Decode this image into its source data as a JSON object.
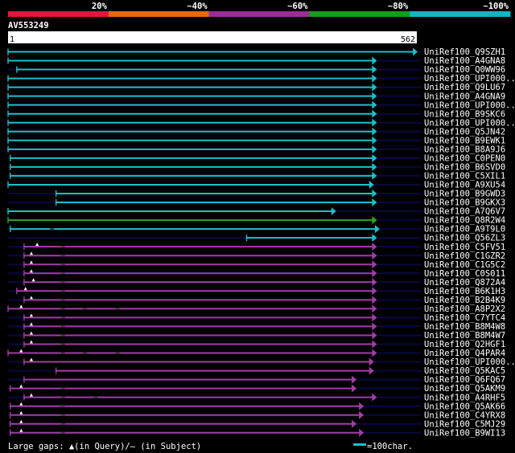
{
  "legend_scale": {
    "labels": [
      "20%",
      "~40%",
      "~60%",
      "~80%",
      "~100%"
    ],
    "colors": [
      "#e5143b",
      "#e06a17",
      "#9a2d98",
      "#1a9b1a",
      "#17b4bf"
    ]
  },
  "query": {
    "name": "AV553249",
    "start": "1",
    "end": "562",
    "length": 562
  },
  "colors": {
    "cyan": "#19c1c9",
    "purple": "#a23da5",
    "green": "#2aa81f",
    "nav": "#080840",
    "gap_mark": "#ffffff"
  },
  "hits": [
    {
      "name": "UniRef100_Q9SZH1",
      "color": "cyan",
      "start": 0,
      "end": 562,
      "gaps": []
    },
    {
      "name": "UniRef100_A4GNA8",
      "color": "cyan",
      "start": 0,
      "end": 506,
      "gaps": []
    },
    {
      "name": "UniRef100_Q0WW96",
      "color": "cyan",
      "start": 12,
      "end": 506,
      "gaps": []
    },
    {
      "name": "UniRef100_UPI000..",
      "color": "cyan",
      "start": 0,
      "end": 506,
      "gaps": []
    },
    {
      "name": "UniRef100_Q9LU67",
      "color": "cyan",
      "start": 0,
      "end": 506,
      "gaps": []
    },
    {
      "name": "UniRef100_A4GNA9",
      "color": "cyan",
      "start": 0,
      "end": 506,
      "gaps": []
    },
    {
      "name": "UniRef100_UPI000..",
      "color": "cyan",
      "start": 0,
      "end": 506,
      "gaps": []
    },
    {
      "name": "UniRef100_B9SKC6",
      "color": "cyan",
      "start": 0,
      "end": 506,
      "gaps": []
    },
    {
      "name": "UniRef100_UPI000..",
      "color": "cyan",
      "start": 0,
      "end": 506,
      "gaps": []
    },
    {
      "name": "UniRef100_Q5JN42",
      "color": "cyan",
      "start": 0,
      "end": 506,
      "gaps": []
    },
    {
      "name": "UniRef100_B9EWK1",
      "color": "cyan",
      "start": 0,
      "end": 506,
      "gaps": []
    },
    {
      "name": "UniRef100_B8A9J6",
      "color": "cyan",
      "start": 0,
      "end": 506,
      "gaps": []
    },
    {
      "name": "UniRef100_C0PEN0",
      "color": "cyan",
      "start": 3,
      "end": 506,
      "gaps": []
    },
    {
      "name": "UniRef100_B6SVD0",
      "color": "cyan",
      "start": 3,
      "end": 506,
      "gaps": []
    },
    {
      "name": "UniRef100_C5XIL1",
      "color": "cyan",
      "start": 3,
      "end": 506,
      "gaps": []
    },
    {
      "name": "UniRef100_A9XU54",
      "color": "cyan",
      "start": 0,
      "end": 502,
      "gaps": []
    },
    {
      "name": "UniRef100_B9GWD3",
      "color": "cyan",
      "start": 66,
      "end": 506,
      "gaps": []
    },
    {
      "name": "UniRef100_B9GKX3",
      "color": "cyan",
      "start": 66,
      "end": 506,
      "gaps": []
    },
    {
      "name": "UniRef100_A7Q6V7",
      "color": "cyan",
      "start": 0,
      "end": 450,
      "gaps": []
    },
    {
      "name": "UniRef100_Q8R2W4",
      "color": "green",
      "start": 0,
      "end": 506,
      "gaps": []
    },
    {
      "name": "UniRef100_A9T9L0",
      "color": "cyan",
      "start": 3,
      "end": 510,
      "gaps": [
        60
      ]
    },
    {
      "name": "UniRef100_Q56ZL3",
      "color": "cyan",
      "start": 328,
      "end": 506,
      "gaps": []
    },
    {
      "name": "UniRef100_C5FV51",
      "color": "purple",
      "start": 22,
      "end": 506,
      "gaps": [
        40,
        75
      ]
    },
    {
      "name": "UniRef100_C1GZR2",
      "color": "purple",
      "start": 22,
      "end": 506,
      "gaps": [
        32,
        75
      ]
    },
    {
      "name": "UniRef100_C1G5C2",
      "color": "purple",
      "start": 22,
      "end": 506,
      "gaps": [
        32,
        75
      ]
    },
    {
      "name": "UniRef100_C0S011",
      "color": "purple",
      "start": 22,
      "end": 506,
      "gaps": [
        32,
        75
      ]
    },
    {
      "name": "UniRef100_Q872A4",
      "color": "purple",
      "start": 22,
      "end": 506,
      "gaps": [
        35,
        75
      ]
    },
    {
      "name": "UniRef100_B6K1H3",
      "color": "purple",
      "start": 12,
      "end": 506,
      "gaps": [
        24,
        75
      ]
    },
    {
      "name": "UniRef100_B2B4K9",
      "color": "purple",
      "start": 22,
      "end": 506,
      "gaps": [
        32,
        75
      ]
    },
    {
      "name": "UniRef100_A8P2X2",
      "color": "purple",
      "start": 0,
      "end": 506,
      "gaps": [
        18,
        75,
        105,
        150
      ]
    },
    {
      "name": "UniRef100_C7YTC4",
      "color": "purple",
      "start": 22,
      "end": 506,
      "gaps": [
        32,
        75
      ]
    },
    {
      "name": "UniRef100_B8M4W8",
      "color": "purple",
      "start": 22,
      "end": 506,
      "gaps": [
        32,
        75
      ]
    },
    {
      "name": "UniRef100_B8M4W7",
      "color": "purple",
      "start": 22,
      "end": 506,
      "gaps": [
        32,
        75
      ]
    },
    {
      "name": "UniRef100_Q2HGF1",
      "color": "purple",
      "start": 22,
      "end": 506,
      "gaps": [
        32,
        75
      ]
    },
    {
      "name": "UniRef100_Q4PAR4",
      "color": "purple",
      "start": 0,
      "end": 506,
      "gaps": [
        18,
        75,
        105,
        150
      ]
    },
    {
      "name": "UniRef100_UPI000..",
      "color": "purple",
      "start": 22,
      "end": 502,
      "gaps": [
        32
      ]
    },
    {
      "name": "UniRef100_Q5KAC5",
      "color": "purple",
      "start": 66,
      "end": 502,
      "gaps": []
    },
    {
      "name": "UniRef100_Q6FQ67",
      "color": "purple",
      "start": 22,
      "end": 478,
      "gaps": []
    },
    {
      "name": "UniRef100_Q5AKM9",
      "color": "purple",
      "start": 3,
      "end": 478,
      "gaps": [
        18,
        75
      ]
    },
    {
      "name": "UniRef100_A4RHF5",
      "color": "purple",
      "start": 22,
      "end": 506,
      "gaps": [
        32,
        75,
        120
      ]
    },
    {
      "name": "UniRef100_Q5AK66",
      "color": "purple",
      "start": 3,
      "end": 488,
      "gaps": [
        18,
        75
      ]
    },
    {
      "name": "UniRef100_C4YRX8",
      "color": "purple",
      "start": 3,
      "end": 488,
      "gaps": [
        18,
        75
      ]
    },
    {
      "name": "UniRef100_C5MJ29",
      "color": "purple",
      "start": 3,
      "end": 478,
      "gaps": [
        18,
        75
      ]
    },
    {
      "name": "UniRef100_B9WI13",
      "color": "purple",
      "start": 3,
      "end": 488,
      "gaps": [
        18,
        75
      ]
    }
  ],
  "footer": {
    "gaps_label": "Large gaps: ▲(in Query)/– (in Subject)",
    "scale_label": "=100char."
  }
}
